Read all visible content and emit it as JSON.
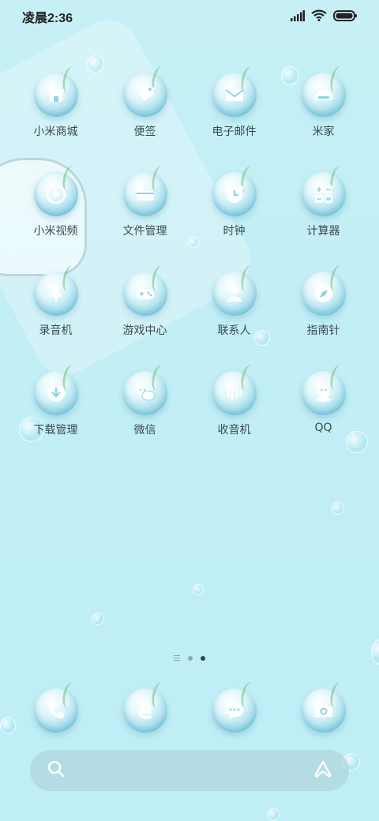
{
  "status_bar": {
    "time": "凌晨2:36",
    "icons": [
      "signal-icon",
      "wifi-icon",
      "battery-icon"
    ]
  },
  "apps": [
    {
      "label": "小米商城",
      "icon": "store-icon"
    },
    {
      "label": "便签",
      "icon": "tag-icon"
    },
    {
      "label": "电子邮件",
      "icon": "mail-icon"
    },
    {
      "label": "米家",
      "icon": "sofa-icon"
    },
    {
      "label": "小米视频",
      "icon": "play-icon"
    },
    {
      "label": "文件管理",
      "icon": "folder-icon"
    },
    {
      "label": "时钟",
      "icon": "clock-icon"
    },
    {
      "label": "计算器",
      "icon": "calculator-icon"
    },
    {
      "label": "录音机",
      "icon": "microphone-icon"
    },
    {
      "label": "游戏中心",
      "icon": "gamepad-icon"
    },
    {
      "label": "联系人",
      "icon": "person-icon"
    },
    {
      "label": "指南针",
      "icon": "compass-icon"
    },
    {
      "label": "下载管理",
      "icon": "download-icon"
    },
    {
      "label": "微信",
      "icon": "wechat-icon"
    },
    {
      "label": "收音机",
      "icon": "radio-icon"
    },
    {
      "label": "QQ",
      "icon": "penguin-icon"
    }
  ],
  "page_indicator": {
    "pages": 2,
    "active": 2
  },
  "dock": [
    {
      "icon": "phone-icon"
    },
    {
      "icon": "browser-icon"
    },
    {
      "icon": "message-icon"
    },
    {
      "icon": "camera-icon"
    }
  ],
  "colors": {
    "background": "#c4eff6",
    "icon_glyph": "#ffffff",
    "label_text": "#3a4a50"
  }
}
